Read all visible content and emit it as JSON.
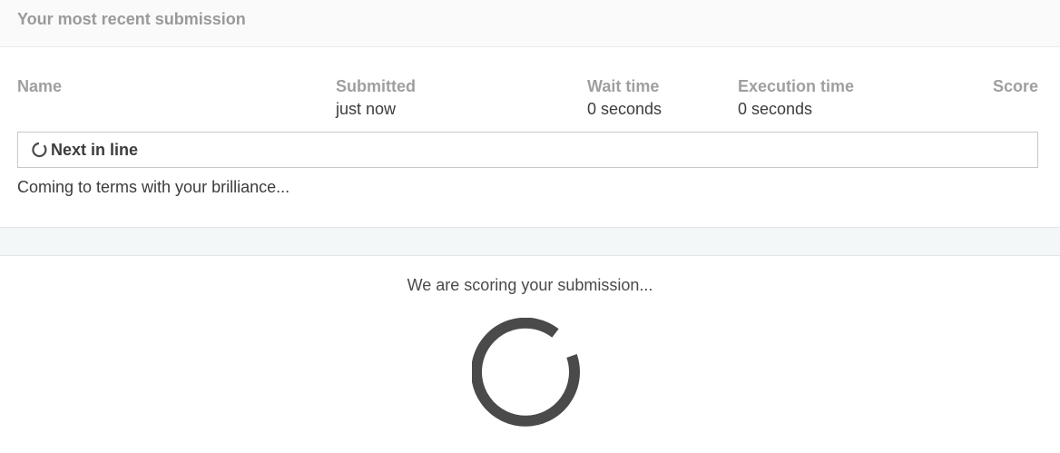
{
  "header": {
    "title": "Your most recent submission"
  },
  "table": {
    "columns": [
      {
        "label": "Name",
        "value": ""
      },
      {
        "label": "Submitted",
        "value": "just now"
      },
      {
        "label": "Wait time",
        "value": "0 seconds"
      },
      {
        "label": "Execution time",
        "value": "0 seconds"
      },
      {
        "label": "Score",
        "value": ""
      }
    ]
  },
  "status": {
    "label": "Next in line",
    "icon": "spinner-icon"
  },
  "message": "Coming to terms with your brilliance...",
  "scoring": {
    "text": "We are scoring your submission...",
    "icon": "loading-spinner-icon"
  },
  "colors": {
    "spinner": "#4a4a4a",
    "header_bg": "#fafafa",
    "band_bg": "#f4f7f7"
  }
}
